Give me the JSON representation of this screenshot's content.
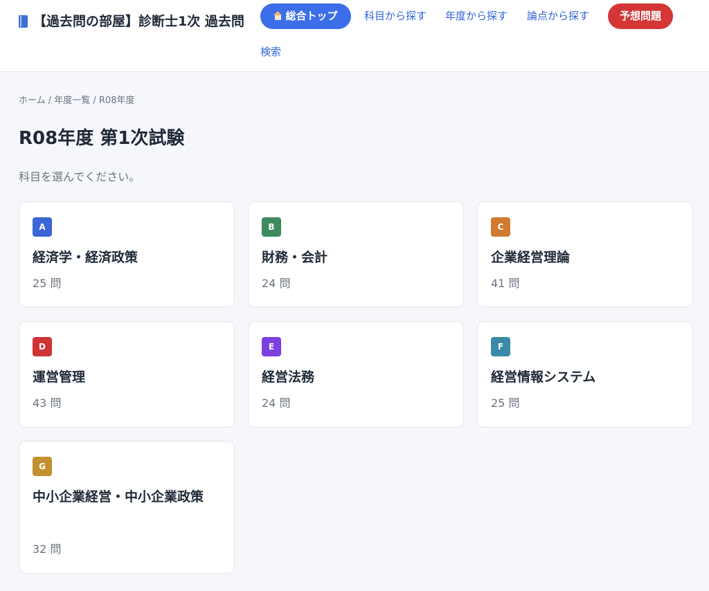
{
  "header": {
    "site_title": "【過去問の部屋】診断士1次 過去問",
    "nav": {
      "top": "総合トップ",
      "by_subject": "科目から探す",
      "by_year": "年度から探す",
      "by_topic": "論点から探す",
      "forecast": "予想問題",
      "search": "検索"
    }
  },
  "breadcrumb": "ホーム / 年度一覧 / R08年度",
  "page_title": "R08年度 第1次試験",
  "instruction": "科目を選んでください。",
  "colors": {
    "nav_top_bg": "#3b6ee8",
    "nav_forecast_bg": "#d43535",
    "link": "#2f63d8"
  },
  "subjects": [
    {
      "letter": "A",
      "name": "経済学・経済政策",
      "count": "25 問",
      "color": "#3a66d6"
    },
    {
      "letter": "B",
      "name": "財務・会計",
      "count": "24 問",
      "color": "#3d8a5e"
    },
    {
      "letter": "C",
      "name": "企業経営理論",
      "count": "41 問",
      "color": "#cf7a2e"
    },
    {
      "letter": "D",
      "name": "運営管理",
      "count": "43 問",
      "color": "#cf3434"
    },
    {
      "letter": "E",
      "name": "経営法務",
      "count": "24 問",
      "color": "#7c3fe0"
    },
    {
      "letter": "F",
      "name": "経営情報システム",
      "count": "25 問",
      "color": "#3a8aa8"
    },
    {
      "letter": "G",
      "name": "中小企業経営・中小企業政策",
      "count": "32 問",
      "color": "#c2902f"
    }
  ]
}
